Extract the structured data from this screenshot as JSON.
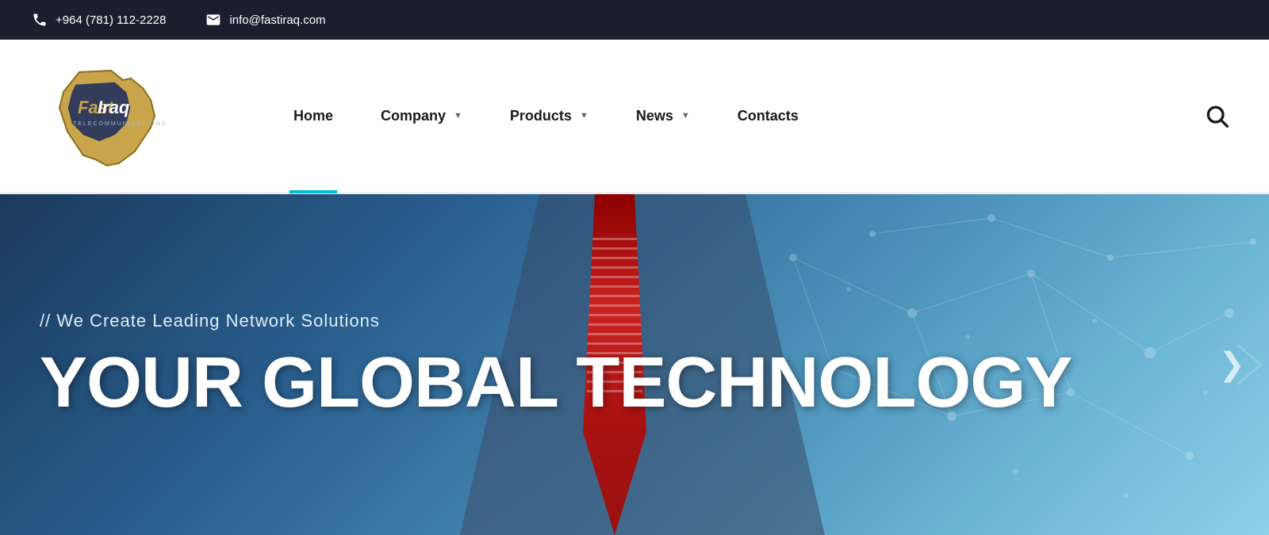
{
  "topbar": {
    "phone": "+964 (781) 112-2228",
    "email": "info@fastiraq.com"
  },
  "logo": {
    "company_name": "Fast Iraq",
    "tagline": "TELECOMMUNICATIONS"
  },
  "nav": {
    "home_label": "Home",
    "company_label": "Company",
    "products_label": "Products",
    "news_label": "News",
    "contacts_label": "Contacts"
  },
  "hero": {
    "subtitle": "// We Create Leading Network Solutions",
    "title": "YOUR GLOBAL TECHNOLOGY"
  }
}
